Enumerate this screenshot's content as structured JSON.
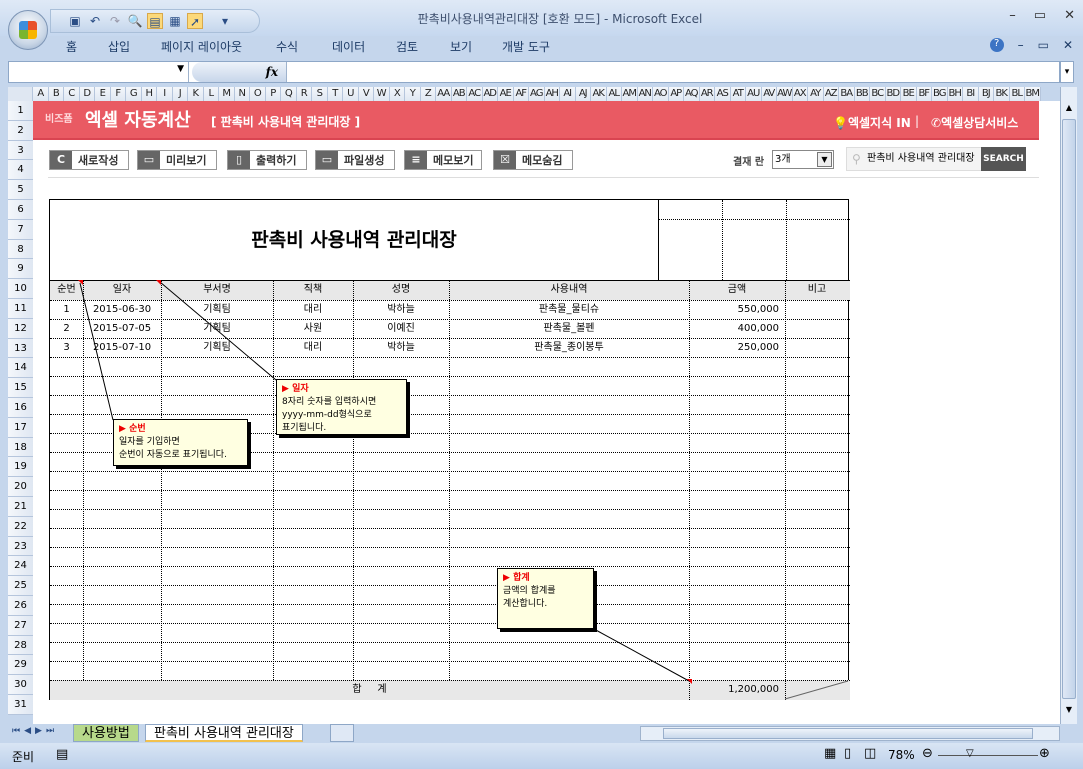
{
  "window": {
    "title": "판촉비사용내역관리대장  [호환 모드] - Microsoft Excel",
    "controls": [
      "–",
      "▭",
      "✕"
    ]
  },
  "ribbon": {
    "tabs": [
      "홈",
      "삽입",
      "페이지 레이아웃",
      "수식",
      "데이터",
      "검토",
      "보기",
      "개발 도구"
    ],
    "help": "?",
    "controls": [
      "–",
      "▭",
      "✕"
    ]
  },
  "formula_bar": {
    "name_box": "",
    "fx": "fx",
    "value": ""
  },
  "columns": [
    "A",
    "B",
    "C",
    "D",
    "E",
    "F",
    "G",
    "H",
    "I",
    "J",
    "K",
    "L",
    "M",
    "N",
    "O",
    "P",
    "Q",
    "R",
    "S",
    "T",
    "U",
    "V",
    "W",
    "X",
    "Y",
    "Z",
    "AA",
    "AB",
    "AC",
    "AD",
    "AE",
    "AF",
    "AG",
    "AH",
    "AI",
    "AJ",
    "AK",
    "AL",
    "AM",
    "AN",
    "AO",
    "AP",
    "AQ",
    "AR",
    "AS",
    "AT",
    "AU",
    "AV",
    "AW",
    "AX",
    "AY",
    "AZ",
    "BA",
    "BB",
    "BC",
    "BD",
    "BE",
    "BF",
    "BG",
    "BH",
    "BI",
    "BJ",
    "BK",
    "BL",
    "BM"
  ],
  "rows": [
    "1",
    "2",
    "3",
    "4",
    "5",
    "6",
    "7",
    "8",
    "9",
    "10",
    "11",
    "12",
    "13",
    "14",
    "15",
    "16",
    "17",
    "18",
    "19",
    "20",
    "21",
    "22",
    "23",
    "24",
    "25",
    "26",
    "27",
    "28",
    "29",
    "30",
    "31"
  ],
  "banner": {
    "brand_small": "비즈폼",
    "brand": "엑셀 자동계산",
    "subtitle": "[ 판촉비 사용내역 관리대장 ]",
    "kin": "엑셀지식 IN",
    "separator": "|",
    "consult": "엑셀상담서비스"
  },
  "toolbar": {
    "buttons": [
      "새로작성",
      "미리보기",
      "출력하기",
      "파일생성",
      "메모보기",
      "메모숨김"
    ],
    "approval_label": "결재 란",
    "approval_value": "3개",
    "search_value": "판촉비 사용내역 관리대장",
    "search_button": "SEARCH"
  },
  "ledger": {
    "title": "판촉비 사용내역 관리대장",
    "headers": [
      "순번",
      "일자",
      "부서명",
      "직책",
      "성명",
      "사용내역",
      "금액",
      "비고"
    ],
    "rows": [
      [
        "1",
        "2015-06-30",
        "기획팀",
        "대리",
        "박하늘",
        "판촉물_물티슈",
        "550,000",
        ""
      ],
      [
        "2",
        "2015-07-05",
        "기획팀",
        "사원",
        "이예진",
        "판촉물_볼펜",
        "400,000",
        ""
      ],
      [
        "3",
        "2015-07-10",
        "기획팀",
        "대리",
        "박하늘",
        "판촉물_종이봉투",
        "250,000",
        ""
      ]
    ],
    "total_label": "합     계",
    "total_value": "1,200,000"
  },
  "memos": [
    {
      "title": "순번",
      "lines": [
        "일자를 기입하면",
        "순번이 자동으로 표기됩니다."
      ]
    },
    {
      "title": "일자",
      "lines": [
        "8자리 숫자를 입력하시면",
        "yyyy-mm-dd형식으로",
        "표기됩니다."
      ]
    },
    {
      "title": "합계",
      "lines": [
        "금액의 합계를",
        "계산합니다."
      ]
    }
  ],
  "sheet_tabs": [
    "사용방법",
    "판촉비 사용내역 관리대장"
  ],
  "status": {
    "ready": "준비",
    "zoom": "78%"
  }
}
